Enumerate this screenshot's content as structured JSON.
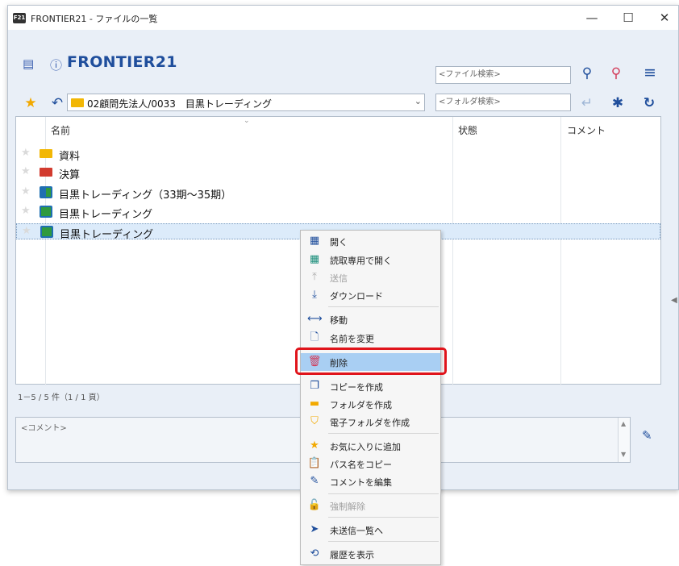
{
  "window": {
    "badge": "F21",
    "title": "FRONTIER21 - ファイルの一覧",
    "minimize": "—",
    "maximize": "☐",
    "close": "✕"
  },
  "header": {
    "brand": "FRONTIER21",
    "file_search_placeholder": "<ファイル検索>",
    "folder_search_placeholder": "<フォルダ検索>",
    "path": "02顧問先法人/0033　目黒トレーディング"
  },
  "list": {
    "columns": [
      "名前",
      "状態",
      "コメント"
    ],
    "rows": [
      {
        "name": "資料",
        "icon": "folder-yellow"
      },
      {
        "name": "決算",
        "icon": "folder-red"
      },
      {
        "name": "目黒トレーディング（33期～35期）",
        "icon": "client-half"
      },
      {
        "name": "目黒トレーディング",
        "icon": "client-green"
      },
      {
        "name": "目黒トレーディング",
        "icon": "client-green",
        "selected": true
      }
    ],
    "count": "1－5 / 5 件（1 / 1 頁）"
  },
  "comment": {
    "placeholder": "<コメント>"
  },
  "context_menu": {
    "items": [
      {
        "label": "開く",
        "icon": "grid-icon"
      },
      {
        "label": "読取専用で開く",
        "icon": "grid-teal-icon"
      },
      {
        "label": "送信",
        "icon": "upload-icon",
        "disabled": true
      },
      {
        "label": "ダウンロード",
        "icon": "download-icon"
      },
      {
        "label": "移動",
        "icon": "move-arrow-icon"
      },
      {
        "label": "名前を変更",
        "icon": "document-icon"
      },
      {
        "label": "削除",
        "icon": "trash-icon",
        "highlighted": true
      },
      {
        "label": "コピーを作成",
        "icon": "copy-icon"
      },
      {
        "label": "フォルダを作成",
        "icon": "folder-icon"
      },
      {
        "label": "電子フォルダを作成",
        "icon": "shield-folder-icon"
      },
      {
        "label": "お気に入りに追加",
        "icon": "star-icon"
      },
      {
        "label": "パス名をコピー",
        "icon": "clipboard-icon"
      },
      {
        "label": "コメントを編集",
        "icon": "pencil-icon"
      },
      {
        "label": "強制解除",
        "icon": "unlock-icon",
        "disabled": true
      },
      {
        "label": "未送信一覧へ",
        "icon": "send-icon"
      },
      {
        "label": "履歴を表示",
        "icon": "history-icon"
      }
    ]
  },
  "colors": {
    "accent": "#1f4e9c",
    "highlight": "#a9cff3",
    "alert_outline": "#e0141b",
    "folder": "#f2b705"
  }
}
